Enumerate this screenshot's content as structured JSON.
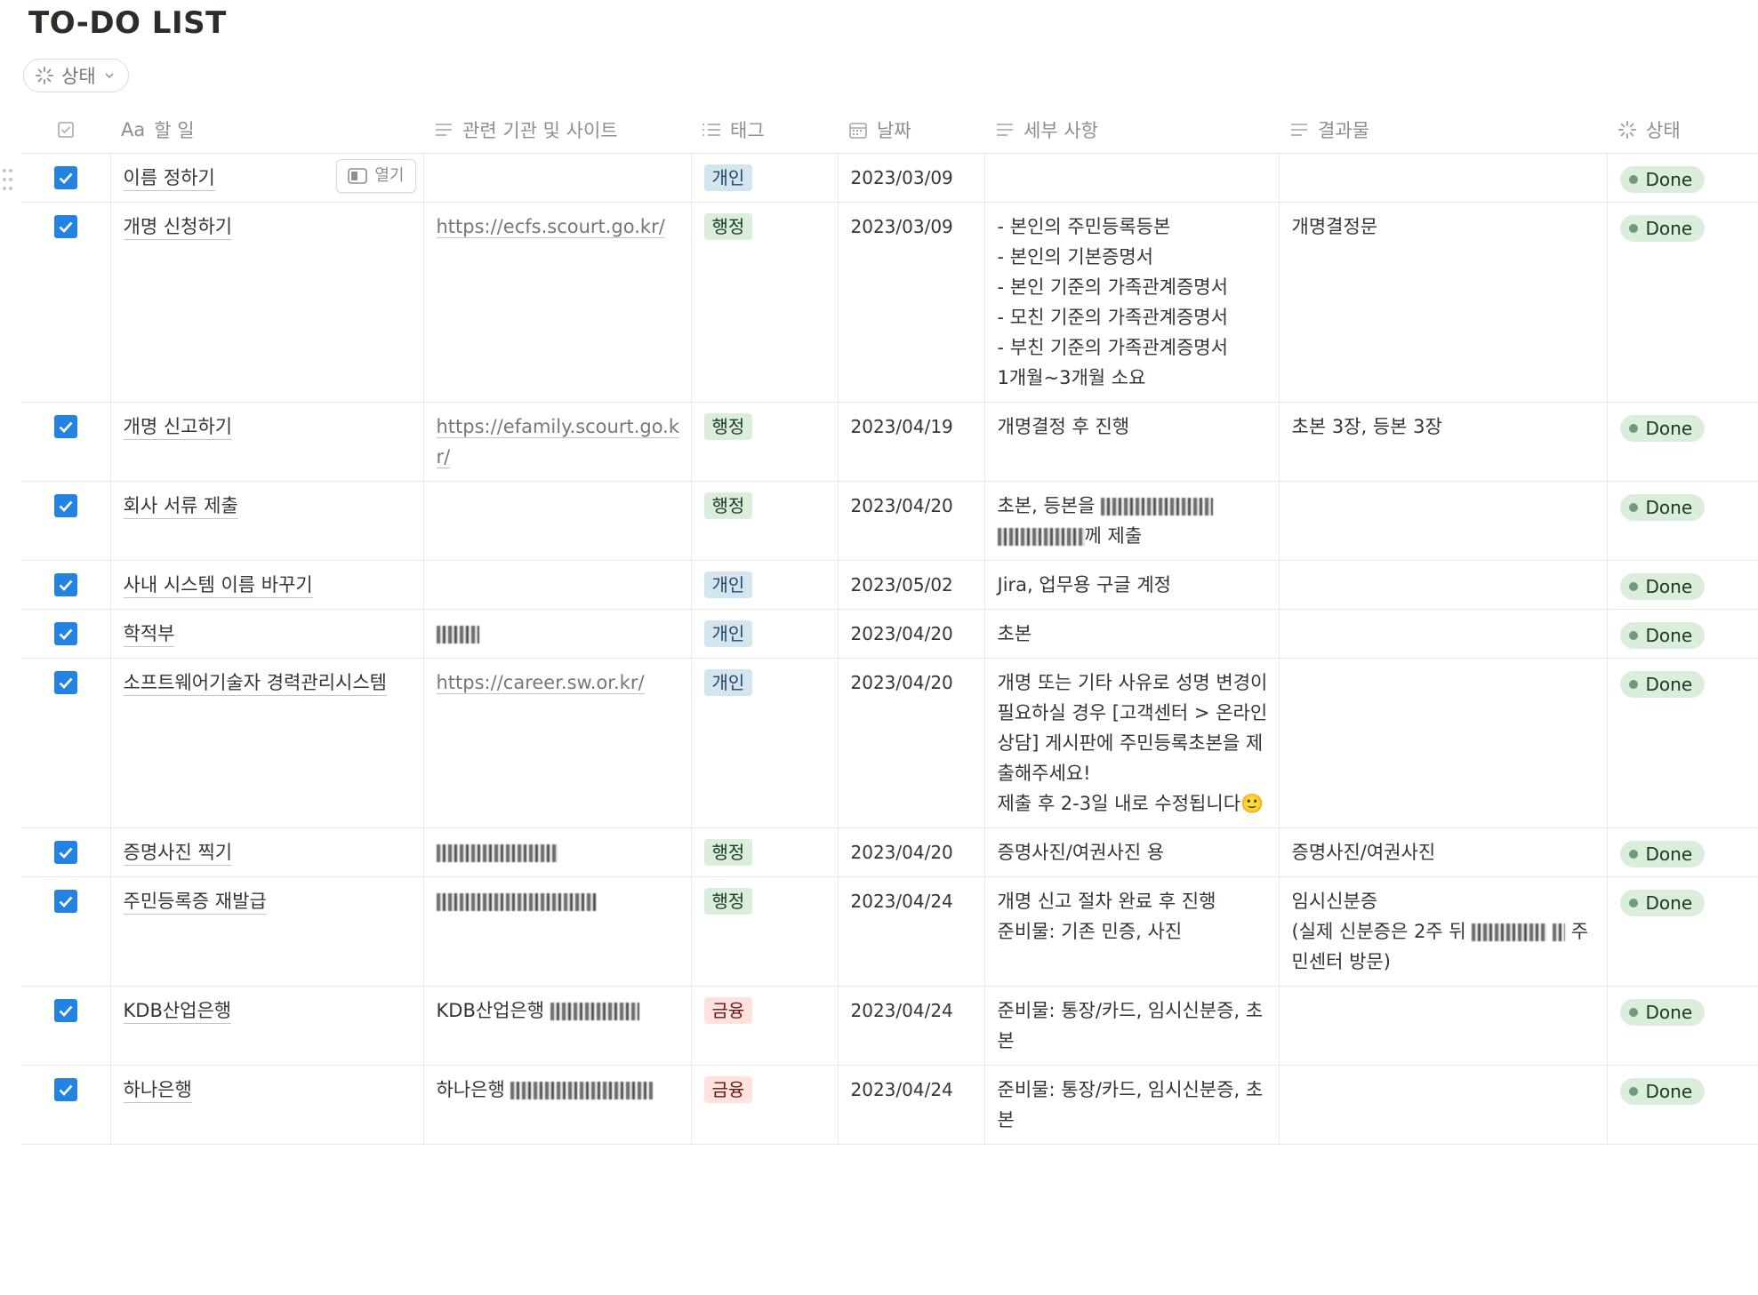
{
  "title": "TO-DO LIST",
  "filter": {
    "label": "상태"
  },
  "columns": [
    {
      "key": "check",
      "label": "",
      "icon": "checkbox-header-icon"
    },
    {
      "key": "task",
      "label": "할 일",
      "prefix": "Aa"
    },
    {
      "key": "site",
      "label": "관련 기관 및 사이트",
      "icon": "text-lines-icon"
    },
    {
      "key": "tag",
      "label": "태그",
      "icon": "list-icon"
    },
    {
      "key": "date",
      "label": "날짜",
      "icon": "calendar-icon"
    },
    {
      "key": "detail",
      "label": "세부 사항",
      "icon": "text-lines-icon"
    },
    {
      "key": "result",
      "label": "결과물",
      "icon": "text-lines-icon"
    },
    {
      "key": "status",
      "label": "상태",
      "icon": "loader-icon"
    }
  ],
  "open_button_label": "열기",
  "tag_colors": {
    "개인": {
      "bg": "#d3e5ef",
      "fg": "#28456c"
    },
    "행정": {
      "bg": "#dbeddb",
      "fg": "#1c3829"
    },
    "금융": {
      "bg": "#ffe2dd",
      "fg": "#5d1715"
    }
  },
  "status_colors": {
    "Done": {
      "bg": "#dbeddb",
      "fg": "#1c3829",
      "dot": "#6c9b7d"
    }
  },
  "rows": [
    {
      "task": "이름 정하기",
      "site": "",
      "site_type": "none",
      "tag": "개인",
      "date": "2023/03/09",
      "detail": "",
      "result": "",
      "status": "Done",
      "hover": true
    },
    {
      "task": "개명 신청하기",
      "site": "https://ecfs.scourt.go.kr/",
      "site_type": "link",
      "tag": "행정",
      "date": "2023/03/09",
      "detail": "- 본인의 주민등록등본\n- 본인의 기본증명서\n- 본인 기준의 가족관계증명서\n- 모친 기준의 가족관계증명서\n- 부친 기준의 가족관계증명서\n1개월~3개월 소요",
      "result": "개명결정문",
      "status": "Done"
    },
    {
      "task": "개명 신고하기",
      "site": "https://efamily.scourt.go.kr/",
      "site_type": "link",
      "tag": "행정",
      "date": "2023/04/19",
      "detail": "개명결정 후 진행",
      "result": "초본 3장, 등본 3장",
      "status": "Done"
    },
    {
      "task": "회사 서류 제출",
      "site": "",
      "site_type": "none",
      "tag": "행정",
      "date": "2023/04/20",
      "detail": "초본, 등본을 ▒▒▒▒▒▒▒▒▒ ▒▒▒▒▒▒▒께 제출",
      "result": "",
      "status": "Done"
    },
    {
      "task": "사내 시스템 이름 바꾸기",
      "site": "",
      "site_type": "none",
      "tag": "개인",
      "date": "2023/05/02",
      "detail": "Jira, 업무용 구글 계정",
      "result": "",
      "status": "Done"
    },
    {
      "task": "학적부",
      "site": "",
      "site_type": "redacted",
      "redact_w": 48,
      "tag": "개인",
      "date": "2023/04/20",
      "detail": "초본",
      "result": "",
      "status": "Done"
    },
    {
      "task": "소프트웨어기술자 경력관리시스템",
      "site": "https://career.sw.or.kr/",
      "site_type": "link",
      "tag": "개인",
      "date": "2023/04/20",
      "detail": "개명 또는 기타 사유로 성명 변경이 필요하실 경우 [고객센터 > 온라인상담] 게시판에 주민등록초본을 제출해주세요!\n제출 후 2-3일 내로 수정됩니다🙂",
      "result": "",
      "status": "Done"
    },
    {
      "task": "증명사진 찍기",
      "site": "",
      "site_type": "redacted",
      "redact_w": 136,
      "tag": "행정",
      "date": "2023/04/20",
      "detail": "증명사진/여권사진 용",
      "result": "증명사진/여권사진",
      "status": "Done"
    },
    {
      "task": "주민등록증 재발급",
      "site": "",
      "site_type": "redacted",
      "redact_w": 180,
      "tag": "행정",
      "date": "2023/04/24",
      "detail": "개명 신고 절차 완료 후 진행\n준비물: 기존 민증, 사진",
      "result": "임시신분증\n(실제 신분증은 2주 뒤 ▒▒▒▒▒▒ ▒ 주민센터 방문)",
      "status": "Done"
    },
    {
      "task": "KDB산업은행",
      "site": "KDB산업은행 ",
      "site_type": "text-redacted",
      "redact_w": 100,
      "tag": "금융",
      "date": "2023/04/24",
      "detail": "준비물: 통장/카드, 임시신분증, 초본",
      "result": "",
      "status": "Done"
    },
    {
      "task": "하나은행",
      "site": "하나은행 ",
      "site_type": "text-redacted",
      "redact_w": 160,
      "tag": "금융",
      "date": "2023/04/24",
      "detail": "준비물: 통장/카드, 임시신분증, 초본",
      "result": "",
      "status": "Done"
    }
  ]
}
